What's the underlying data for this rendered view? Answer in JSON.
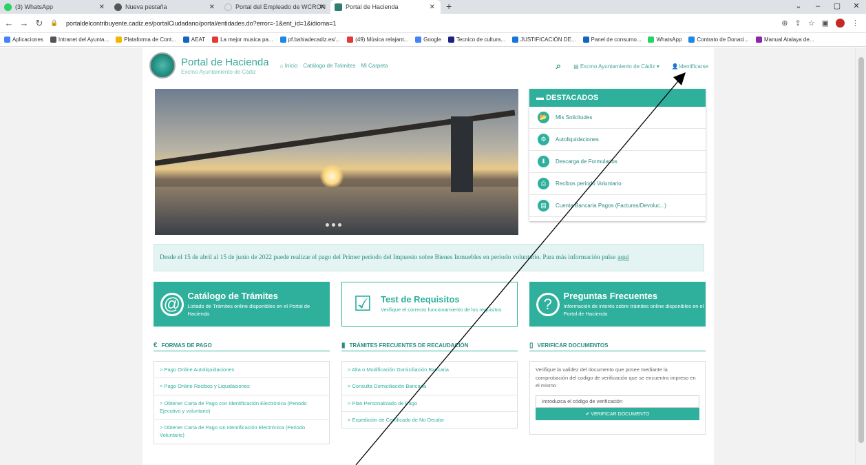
{
  "browser": {
    "tabs": [
      {
        "label": "(3) WhatsApp",
        "color": "#25d366"
      },
      {
        "label": "Nueva pestaña",
        "color": "#555555"
      },
      {
        "label": "Portal del Empleado de WCRON",
        "color": "#bbbbbb"
      },
      {
        "label": "Portal de Hacienda",
        "color": "#2e7d6f"
      }
    ],
    "new_tab": "+",
    "window_controls": [
      "⌄",
      "–",
      "▢",
      "✕"
    ],
    "url": "portaldelcontribuyente.cadiz.es/portalCiudadano/portal/entidades.do?error=-1&ent_id=1&idioma=1",
    "bookmarks": [
      {
        "label": "Aplicaciones",
        "color": "#4285f4"
      },
      {
        "label": "Intranet del Ayunta...",
        "color": "#555555"
      },
      {
        "label": "Plataforma de Cont...",
        "color": "#f4b400"
      },
      {
        "label": "AEAT",
        "color": "#1565c0"
      },
      {
        "label": "La mejor musica pa...",
        "color": "#e53935"
      },
      {
        "label": "pf.bahiadecadiz.es/...",
        "color": "#1e88e5"
      },
      {
        "label": "(49) Música relajant...",
        "color": "#e53935"
      },
      {
        "label": "Google",
        "color": "#4285f4"
      },
      {
        "label": "Tecnico de cultura...",
        "color": "#1a237e"
      },
      {
        "label": "JUSTIFICACIÓN DE...",
        "color": "#1976d2"
      },
      {
        "label": "Panel de consumo...",
        "color": "#1565c0"
      },
      {
        "label": "WhatsApp",
        "color": "#25d366"
      },
      {
        "label": "Contrato de Donaci...",
        "color": "#1e88e5"
      },
      {
        "label": "Manual Atalaya de...",
        "color": "#8e24aa"
      }
    ]
  },
  "portal": {
    "title": "Portal de Hacienda",
    "subtitle": "Excmo Ayuntamiento de Cádiz",
    "menu": [
      "⌂ Inicio",
      "Catálogo de Trámites",
      "Mi Carpeta"
    ],
    "entity_selector": "Excmo Ayuntamiento de Cádiz ▾",
    "login": "Identificarse",
    "destacados_title": "DESTACADOS",
    "destacados": [
      {
        "label": "Mis Solicitudes",
        "icon": "📂"
      },
      {
        "label": "Autoliquidaciones",
        "icon": "⚙"
      },
      {
        "label": "Descarga de Formularios",
        "icon": "⬇"
      },
      {
        "label": "Recibos periodo Voluntario",
        "icon": "⎙"
      },
      {
        "label": "Cuenta Bancaria Pagos (Facturas/Devoluc...)",
        "icon": "▤"
      }
    ],
    "notice": "Desde el 15 de abril al 15 de junio de 2022 puede realizar el pago del Primer periodo del Impuesto sobre Bienes Inmuebles en periodo voluntario. Para más información pulse",
    "notice_link": "aquí",
    "cards": [
      {
        "title": "Catálogo de Trámites",
        "desc": "Listado de Trámites online disponibles en el Portal de Hacienda",
        "icon": "@"
      },
      {
        "title": "Test de Requisitos",
        "desc": "Verifique el correcto funcionamiento de los requisitos",
        "icon": "☑"
      },
      {
        "title": "Preguntas Frecuentes",
        "desc": "Información de interés sobre trámites online disponibles en el Portal de Hacienda",
        "icon": "?"
      }
    ],
    "formas_pago": {
      "title": "FORMAS DE PAGO",
      "items": [
        "> Pago Online Autoliquidaciones",
        "> Pago Online Recibos y Liquidaciones",
        "> Obtener Carta de Pago con Identificación Electrónica (Periodo Ejecutivo y voluntario)",
        "> Obtener Carta de Pago sin Identificación Electrónica (Periodo Voluntario)"
      ]
    },
    "tramites": {
      "title": "TRÁMITES FRECUENTES DE RECAUDACIÓN",
      "items": [
        "> Alta o Modificación Domiciliación Bancaria",
        "> Consulta Domiciliación Bancaria",
        "> Plan Personalizado de Pago",
        "> Expedición de Certificado de No Deudor"
      ]
    },
    "verificar": {
      "title": "VERIFICAR DOCUMENTOS",
      "text": "Verifique la validez del documento que posee mediante la comprobación del codigo de verificación que se encuentra impreso en el mismo",
      "placeholder": "Introduzca el código de verificación",
      "button": "✔ VERIFICAR DOCUMENTO"
    }
  }
}
